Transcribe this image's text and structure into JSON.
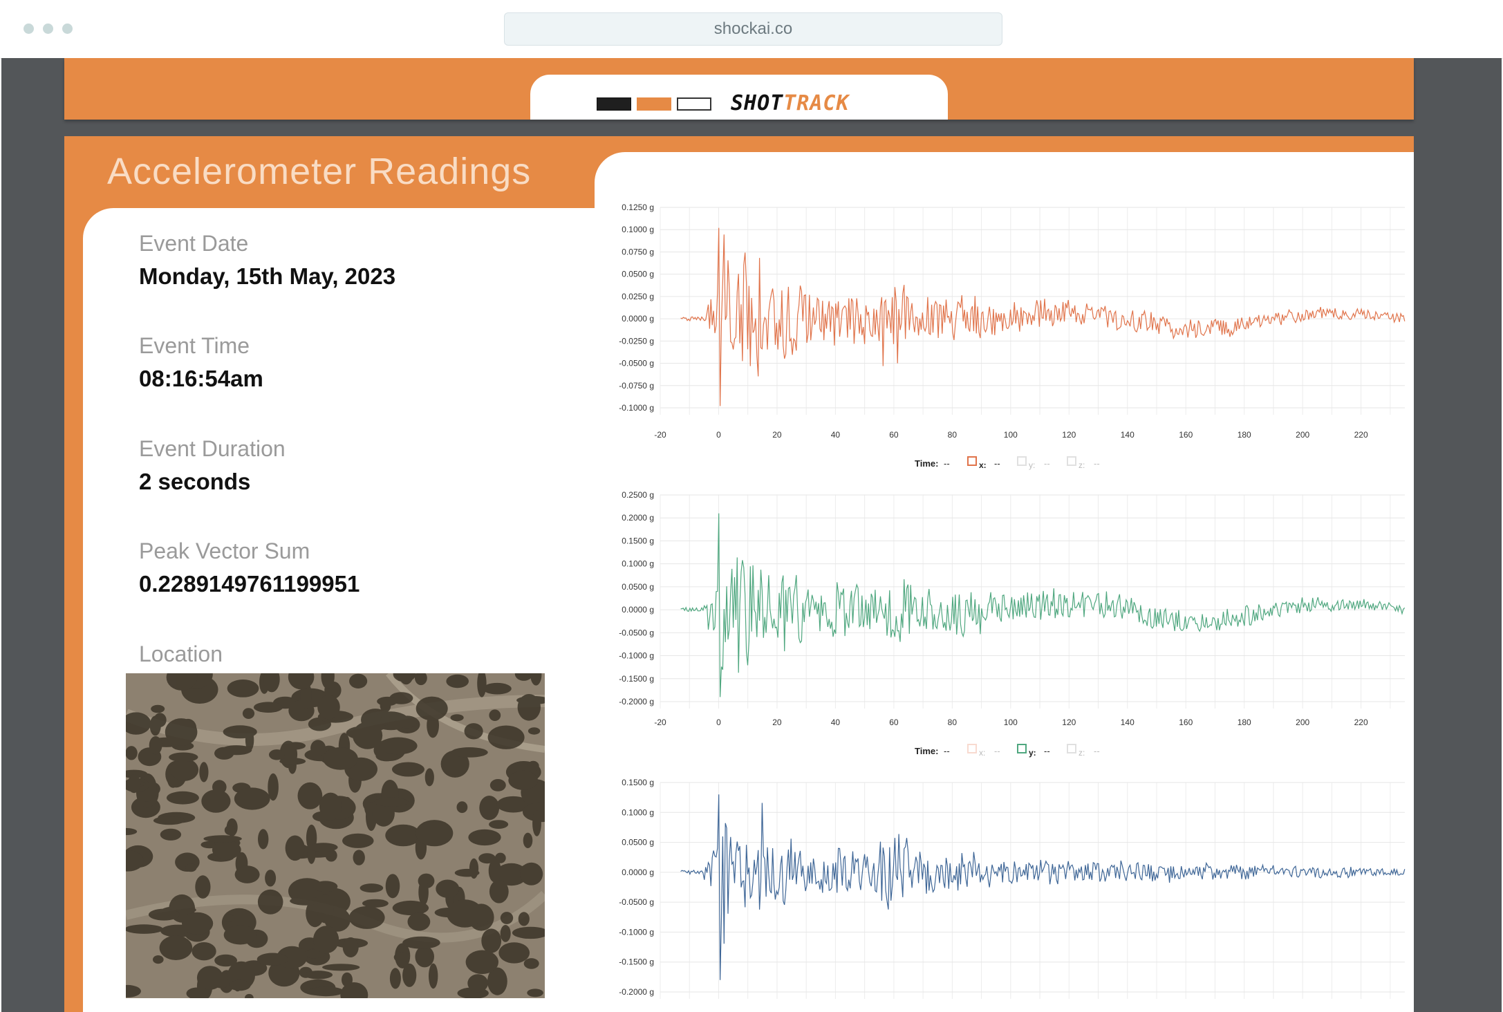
{
  "browser": {
    "url": "shockai.co"
  },
  "header": {
    "logo_shot": "SHOT",
    "logo_track": "TRACK",
    "logo_blocks": [
      "#1f1f1f",
      "#e68a45",
      "#ffffff"
    ]
  },
  "panel": {
    "title": "Accelerometer Readings"
  },
  "info": {
    "event_date_label": "Event Date",
    "event_date": "Monday, 15th May, 2023",
    "event_time_label": "Event Time",
    "event_time": "08:16:54am",
    "event_duration_label": "Event Duration",
    "event_duration": "2 seconds",
    "peak_label": "Peak Vector Sum",
    "peak_value": "0.2289149761199951",
    "location_label": "Location"
  },
  "colors": {
    "accent": "#e68a45",
    "dark": "#535659",
    "x_series": "#e0734a",
    "y_series": "#4fa77f",
    "z_series": "#3d6596"
  },
  "chart_data": [
    {
      "type": "line",
      "series": [
        {
          "name": "x",
          "color": "#e0734a"
        }
      ],
      "xlim": [
        -20,
        235
      ],
      "ylim": [
        -0.1,
        0.125
      ],
      "x_ticks": [
        -20,
        0,
        20,
        40,
        60,
        80,
        100,
        120,
        140,
        160,
        180,
        200,
        220
      ],
      "y_ticks": [
        0.125,
        0.1,
        0.075,
        0.05,
        0.025,
        0.0,
        -0.025,
        -0.05,
        -0.075,
        -0.1
      ],
      "y_tick_labels": [
        "0.1250 g",
        "0.1000 g",
        "0.0750 g",
        "0.0500 g",
        "0.0250 g",
        "0.0000 g",
        "-0.0250 g",
        "-0.0500 g",
        "-0.0750 g",
        "-0.1000 g"
      ],
      "legend": {
        "time_label": "Time:",
        "time_value": "--",
        "items": [
          {
            "key": "x:",
            "value": "--",
            "active": true
          },
          {
            "key": "y:",
            "value": "--",
            "active": false
          },
          {
            "key": "z:",
            "value": "--",
            "active": false
          }
        ]
      },
      "peaks": {
        "max": 0.102,
        "min": -0.098
      }
    },
    {
      "type": "line",
      "series": [
        {
          "name": "y",
          "color": "#4fa77f"
        }
      ],
      "xlim": [
        -20,
        235
      ],
      "ylim": [
        -0.2,
        0.25
      ],
      "x_ticks": [
        -20,
        0,
        20,
        40,
        60,
        80,
        100,
        120,
        140,
        160,
        180,
        200,
        220
      ],
      "y_ticks": [
        0.25,
        0.2,
        0.15,
        0.1,
        0.05,
        0.0,
        -0.05,
        -0.1,
        -0.15,
        -0.2
      ],
      "y_tick_labels": [
        "0.2500 g",
        "0.2000 g",
        "0.1500 g",
        "0.1000 g",
        "0.0500 g",
        "0.0000 g",
        "-0.0500 g",
        "-0.1000 g",
        "-0.1500 g",
        "-0.2000 g"
      ],
      "legend": {
        "time_label": "Time:",
        "time_value": "--",
        "items": [
          {
            "key": "x:",
            "value": "--",
            "active": false
          },
          {
            "key": "y:",
            "value": "--",
            "active": true
          },
          {
            "key": "z:",
            "value": "--",
            "active": false
          }
        ]
      },
      "peaks": {
        "max": 0.21,
        "min": -0.19
      }
    },
    {
      "type": "line",
      "series": [
        {
          "name": "z",
          "color": "#3d6596"
        }
      ],
      "xlim": [
        -20,
        235
      ],
      "ylim": [
        -0.2,
        0.15
      ],
      "y_ticks": [
        0.15,
        0.1,
        0.05,
        0.0,
        -0.05,
        -0.1,
        -0.15,
        -0.2
      ],
      "y_tick_labels": [
        "0.1500 g",
        "0.1000 g",
        "0.0500 g",
        "0.0000 g",
        "-0.0500 g",
        "-0.1000 g",
        "-0.1500 g",
        "-0.2000 g"
      ],
      "peaks": {
        "max": 0.13,
        "min": -0.18
      }
    }
  ]
}
